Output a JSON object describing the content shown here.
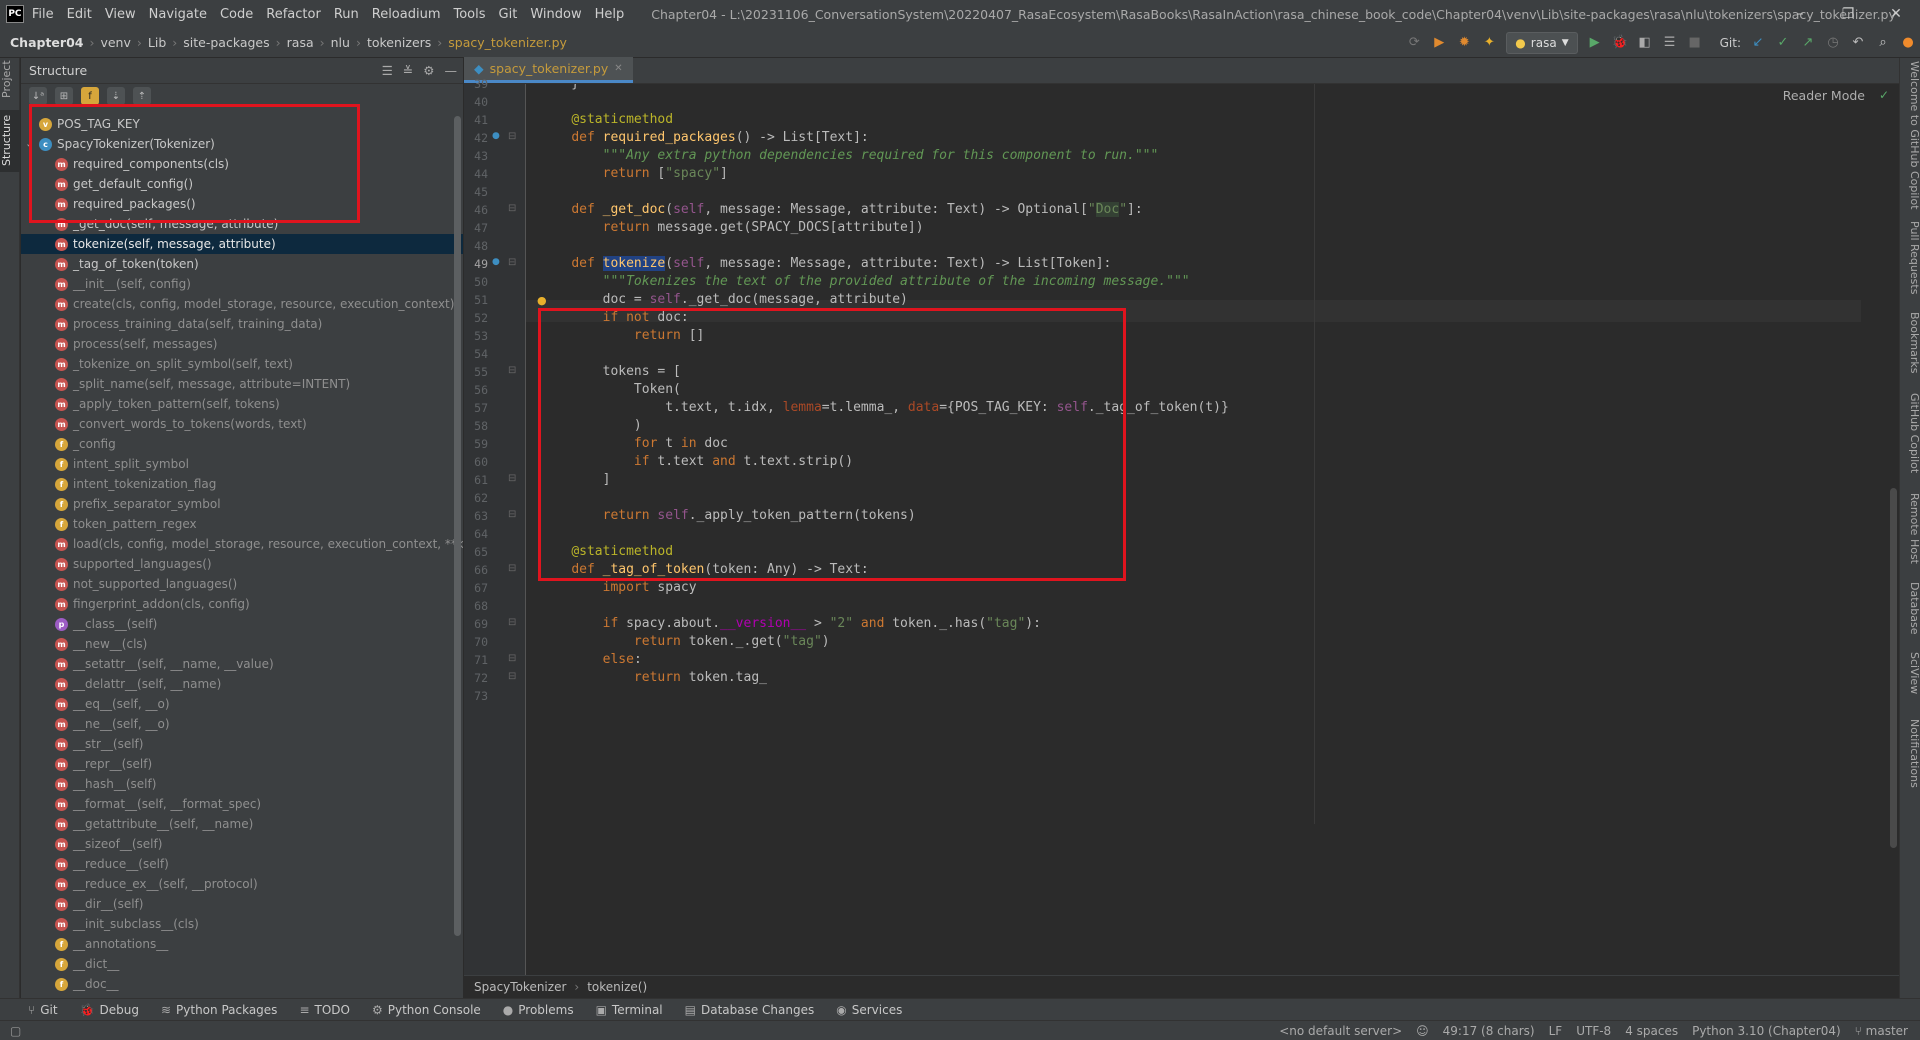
{
  "titlebar": {
    "logo": "PC",
    "menu": [
      "File",
      "Edit",
      "View",
      "Navigate",
      "Code",
      "Refactor",
      "Run",
      "Reloadium",
      "Tools",
      "Git",
      "Window",
      "Help"
    ],
    "title": "Chapter04 - L:\\20231106_ConversationSystem\\20220407_RasaEcosystem\\RasaBooks\\RasaInAction\\rasa_chinese_book_code\\Chapter04\\venv\\Lib\\site-packages\\rasa\\nlu\\tokenizers\\spacy_tokenizer.py",
    "controls": [
      "–",
      "❐",
      "✕"
    ]
  },
  "navbar": {
    "crumbs": [
      "Chapter04",
      "venv",
      "Lib",
      "site-packages",
      "rasa",
      "nlu",
      "tokenizers"
    ],
    "file": "spacy_tokenizer.py",
    "run_config": "rasa",
    "git_label": "Git:"
  },
  "left_strip": {
    "project": "Project",
    "structure": "Structure"
  },
  "structure": {
    "title": "Structure",
    "nodes": [
      {
        "label": "POS_TAG_KEY",
        "kind": "v",
        "inh": false,
        "level": 1
      },
      {
        "label": "SpacyTokenizer(Tokenizer)",
        "kind": "c",
        "inh": false,
        "level": 1
      },
      {
        "label": "required_components(cls)",
        "kind": "m",
        "inh": false,
        "level": 2
      },
      {
        "label": "get_default_config()",
        "kind": "m",
        "inh": false,
        "level": 2
      },
      {
        "label": "required_packages()",
        "kind": "m",
        "inh": false,
        "level": 2
      },
      {
        "label": "_get_doc(self, message, attribute)",
        "kind": "m",
        "inh": false,
        "level": 2
      },
      {
        "label": "tokenize(self, message, attribute)",
        "kind": "m",
        "inh": false,
        "level": 2,
        "selected": true
      },
      {
        "label": "_tag_of_token(token)",
        "kind": "m",
        "inh": false,
        "level": 2
      },
      {
        "label": "__init__(self, config)",
        "kind": "m",
        "inh": true,
        "level": 2
      },
      {
        "label": "create(cls, config, model_storage, resource, execution_context)",
        "kind": "m",
        "inh": true,
        "level": 2
      },
      {
        "label": "process_training_data(self, training_data)",
        "kind": "m",
        "inh": true,
        "level": 2
      },
      {
        "label": "process(self, messages)",
        "kind": "m",
        "inh": true,
        "level": 2
      },
      {
        "label": "_tokenize_on_split_symbol(self, text)",
        "kind": "m",
        "inh": true,
        "level": 2
      },
      {
        "label": "_split_name(self, message, attribute=INTENT)",
        "kind": "m",
        "inh": true,
        "level": 2
      },
      {
        "label": "_apply_token_pattern(self, tokens)",
        "kind": "m",
        "inh": true,
        "level": 2
      },
      {
        "label": "_convert_words_to_tokens(words, text)",
        "kind": "m",
        "inh": true,
        "level": 2
      },
      {
        "label": "_config",
        "kind": "f",
        "inh": true,
        "level": 2
      },
      {
        "label": "intent_split_symbol",
        "kind": "f",
        "inh": true,
        "level": 2
      },
      {
        "label": "intent_tokenization_flag",
        "kind": "f",
        "inh": true,
        "level": 2
      },
      {
        "label": "prefix_separator_symbol",
        "kind": "f",
        "inh": true,
        "level": 2
      },
      {
        "label": "token_pattern_regex",
        "kind": "f",
        "inh": true,
        "level": 2
      },
      {
        "label": "load(cls, config, model_storage, resource, execution_context, **kw",
        "kind": "m",
        "inh": true,
        "level": 2
      },
      {
        "label": "supported_languages()",
        "kind": "m",
        "inh": true,
        "level": 2
      },
      {
        "label": "not_supported_languages()",
        "kind": "m",
        "inh": true,
        "level": 2
      },
      {
        "label": "fingerprint_addon(cls, config)",
        "kind": "m",
        "inh": true,
        "level": 2
      },
      {
        "label": "__class__(self)",
        "kind": "p",
        "inh": true,
        "level": 2
      },
      {
        "label": "__new__(cls)",
        "kind": "m",
        "inh": true,
        "level": 2
      },
      {
        "label": "__setattr__(self, __name, __value)",
        "kind": "m",
        "inh": true,
        "level": 2
      },
      {
        "label": "__delattr__(self, __name)",
        "kind": "m",
        "inh": true,
        "level": 2
      },
      {
        "label": "__eq__(self, __o)",
        "kind": "m",
        "inh": true,
        "level": 2
      },
      {
        "label": "__ne__(self, __o)",
        "kind": "m",
        "inh": true,
        "level": 2
      },
      {
        "label": "__str__(self)",
        "kind": "m",
        "inh": true,
        "level": 2
      },
      {
        "label": "__repr__(self)",
        "kind": "m",
        "inh": true,
        "level": 2
      },
      {
        "label": "__hash__(self)",
        "kind": "m",
        "inh": true,
        "level": 2
      },
      {
        "label": "__format__(self, __format_spec)",
        "kind": "m",
        "inh": true,
        "level": 2
      },
      {
        "label": "__getattribute__(self, __name)",
        "kind": "m",
        "inh": true,
        "level": 2
      },
      {
        "label": "__sizeof__(self)",
        "kind": "m",
        "inh": true,
        "level": 2
      },
      {
        "label": "__reduce__(self)",
        "kind": "m",
        "inh": true,
        "level": 2
      },
      {
        "label": "__reduce_ex__(self, __protocol)",
        "kind": "m",
        "inh": true,
        "level": 2
      },
      {
        "label": "__dir__(self)",
        "kind": "m",
        "inh": true,
        "level": 2
      },
      {
        "label": "__init_subclass__(cls)",
        "kind": "m",
        "inh": true,
        "level": 2
      },
      {
        "label": "__annotations__",
        "kind": "f",
        "inh": true,
        "level": 2
      },
      {
        "label": "__dict__",
        "kind": "f",
        "inh": true,
        "level": 2
      },
      {
        "label": "__doc__",
        "kind": "f",
        "inh": true,
        "level": 2
      }
    ]
  },
  "editor": {
    "tab": "spacy_tokenizer.py",
    "reader_mode": "Reader Mode",
    "current_line": 49,
    "lines": [
      {
        "n": 39,
        "html": "    }"
      },
      {
        "n": 40,
        "html": ""
      },
      {
        "n": 41,
        "html": "    <span class=\"dec\">@staticmethod</span>"
      },
      {
        "n": 42,
        "html": "    <span class=\"kw\">def </span><span class=\"fn\">required_packages</span>() -> List[Text]:"
      },
      {
        "n": 43,
        "html": "        <span class=\"doc\">\"\"\"Any extra python dependencies required for this component to run.\"\"\"</span>"
      },
      {
        "n": 44,
        "html": "        <span class=\"kw\">return </span>[<span class=\"st\">\"spacy\"</span>]"
      },
      {
        "n": 45,
        "html": ""
      },
      {
        "n": 46,
        "html": "    <span class=\"kw\">def </span><span class=\"fn\">_get_doc</span>(<span class=\"slf\">self</span>, message: Message, attribute: Text) -> Optional[<span class=\"st\">\"<span class=\"hl\">Doc</span>\"</span>]:"
      },
      {
        "n": 47,
        "html": "        <span class=\"kw\">return </span>message.get(SPACY_DOCS[attribute])"
      },
      {
        "n": 48,
        "html": ""
      },
      {
        "n": 49,
        "html": "    <span class=\"kw\">def </span><span class=\"fn tok\">tokenize</span>(<span class=\"slf\">self</span>, message: Message, attribute: Text) -> List[Token]:"
      },
      {
        "n": 50,
        "html": "        <span class=\"doc\">\"\"\"Tokenizes the text of the provided attribute of the incoming message.\"\"\"</span>"
      },
      {
        "n": 51,
        "html": "        doc = <span class=\"slf\">self</span>._get_doc(message, attribute)"
      },
      {
        "n": 52,
        "html": "        <span class=\"kw\">if not </span>doc:"
      },
      {
        "n": 53,
        "html": "            <span class=\"kw\">return </span>[]"
      },
      {
        "n": 54,
        "html": ""
      },
      {
        "n": 55,
        "html": "        tokens = ["
      },
      {
        "n": 56,
        "html": "            Token("
      },
      {
        "n": 57,
        "html": "                t.text, t.idx, <span class=\"prm\">lemma</span>=t.lemma_, <span class=\"prm\">data</span>={POS_TAG_KEY: <span class=\"slf\">self</span>._tag_of_token(t)}"
      },
      {
        "n": 58,
        "html": "            )"
      },
      {
        "n": 59,
        "html": "            <span class=\"kw\">for </span>t <span class=\"kw\">in </span>doc"
      },
      {
        "n": 60,
        "html": "            <span class=\"kw\">if </span>t.text <span class=\"kw\">and </span>t.text.strip()"
      },
      {
        "n": 61,
        "html": "        ]"
      },
      {
        "n": 62,
        "html": ""
      },
      {
        "n": 63,
        "html": "        <span class=\"kw\">return </span><span class=\"slf\">self</span>._apply_token_pattern(tokens)"
      },
      {
        "n": 64,
        "html": ""
      },
      {
        "n": 65,
        "html": "    <span class=\"dec\">@staticmethod</span>"
      },
      {
        "n": 66,
        "html": "    <span class=\"kw\">def </span><span class=\"fn\">_tag_of_token</span>(token: Any) -> Text:"
      },
      {
        "n": 67,
        "html": "        <span class=\"kw\">import </span>spacy"
      },
      {
        "n": 68,
        "html": ""
      },
      {
        "n": 69,
        "html": "        <span class=\"kw\">if </span>spacy.about.<span class=\"dnd\">__version__</span> > <span class=\"st\">\"2\"</span> <span class=\"kw\">and </span>token._.has(<span class=\"st\">\"tag\"</span>):"
      },
      {
        "n": 70,
        "html": "            <span class=\"kw\">return </span>token._.get(<span class=\"st\">\"tag\"</span>)"
      },
      {
        "n": 71,
        "html": "        <span class=\"kw\">else</span>:"
      },
      {
        "n": 72,
        "html": "            <span class=\"kw\">return </span>token.tag_"
      },
      {
        "n": 73,
        "html": ""
      }
    ],
    "breadcrumb": [
      "SpacyTokenizer",
      "tokenize()"
    ]
  },
  "right_strip": [
    "Welcome to GitHub Copilot",
    "Pull Requests",
    "Bookmarks",
    "GitHub Copilot",
    "Remote Host",
    "Database",
    "SciView",
    "Notifications"
  ],
  "toolwindows": [
    {
      "icon": "⑂",
      "label": "Git"
    },
    {
      "icon": "🐞",
      "label": "Debug"
    },
    {
      "icon": "≋",
      "label": "Python Packages"
    },
    {
      "icon": "≡",
      "label": "TODO"
    },
    {
      "icon": "⚙",
      "label": "Python Console"
    },
    {
      "icon": "●",
      "label": "Problems"
    },
    {
      "icon": "▣",
      "label": "Terminal"
    },
    {
      "icon": "▤",
      "label": "Database Changes"
    },
    {
      "icon": "◉",
      "label": "Services"
    }
  ],
  "statusbar": {
    "server": "<no default server>",
    "position": "49:17 (8 chars)",
    "line_sep": "LF",
    "encoding": "UTF-8",
    "indent": "4 spaces",
    "interpreter": "Python 3.10 (Chapter04)",
    "branch": "master"
  },
  "colors": {
    "accent": "#4a88c7",
    "annotation_box": "#e0141e",
    "selection": "#0d293e"
  }
}
